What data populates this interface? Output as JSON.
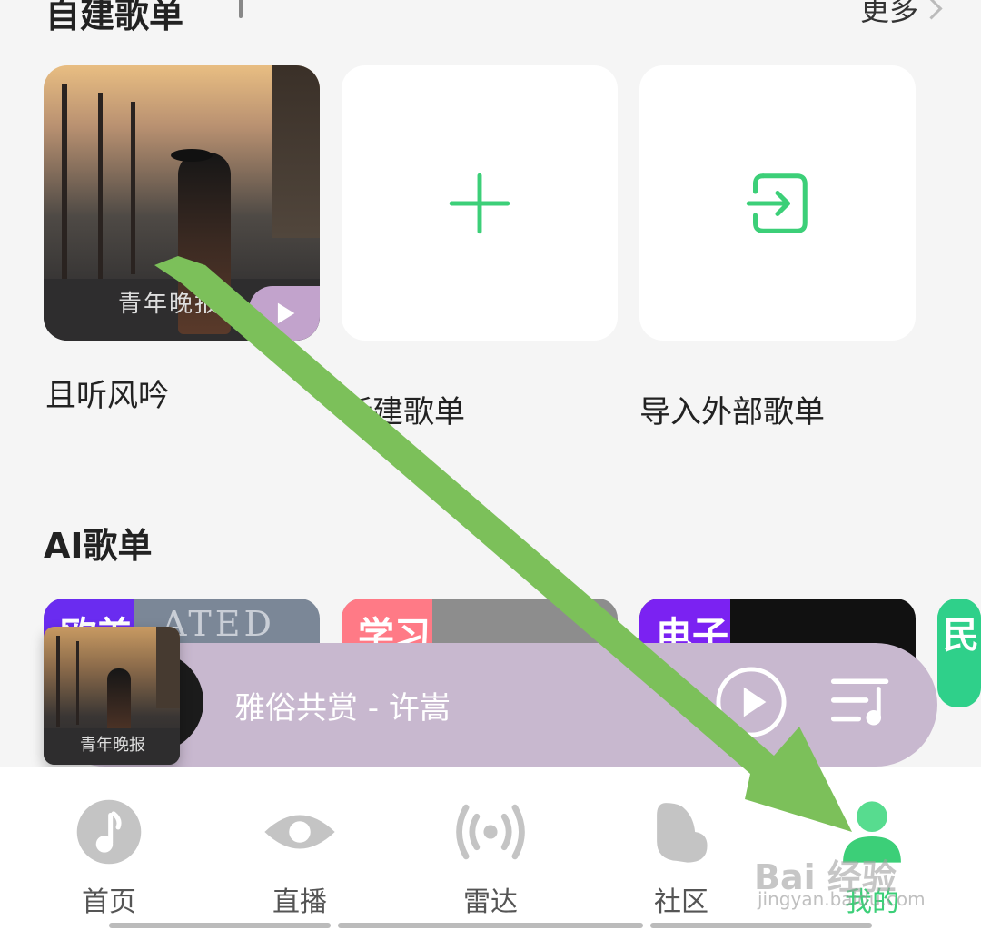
{
  "section_self": {
    "title": "自建歌单",
    "more_label": "更多"
  },
  "playlists": [
    {
      "label": "且听风吟",
      "cover_caption": "青年晚报"
    },
    {
      "label": "新建歌单"
    },
    {
      "label": "导入外部歌单"
    }
  ],
  "section_ai": {
    "title": "AI歌单",
    "cards": [
      {
        "tag": "欧美",
        "color": "#6a2cf0",
        "bg": "#7b8797",
        "bg_text": "ATED"
      },
      {
        "tag": "学习",
        "color": "#ff7a86",
        "bg": "#8d8d8d",
        "bg_text": ""
      },
      {
        "tag": "电子",
        "color": "#7b22f2",
        "bg": "#111111",
        "bg_text": ""
      },
      {
        "tag": "民",
        "color": "#2fd08a",
        "bg": "#2fd08a",
        "bg_text": ""
      }
    ]
  },
  "mini_player": {
    "song": "雅俗共赏 - 许嵩",
    "cover_caption": "青年晚报"
  },
  "tabs": [
    {
      "label": "首页",
      "icon": "music-note-icon"
    },
    {
      "label": "直播",
      "icon": "eye-icon"
    },
    {
      "label": "雷达",
      "icon": "radar-icon"
    },
    {
      "label": "社区",
      "icon": "community-icon"
    },
    {
      "label": "我的",
      "icon": "profile-icon",
      "active": true
    }
  ],
  "watermark": {
    "text": "Bai 经验",
    "sub": "jingyan.baidu.com"
  },
  "colors": {
    "accent": "#3ccf78",
    "player_bg": "#c8b8cf",
    "arrow": "#7cc05a"
  }
}
